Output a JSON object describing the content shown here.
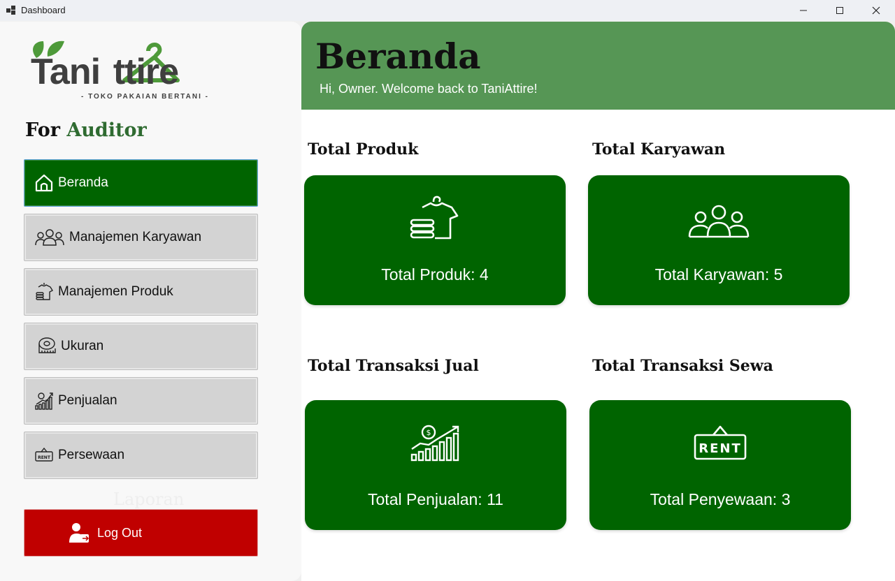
{
  "window": {
    "title": "Dashboard"
  },
  "sidebar": {
    "logo_text": "Tani  ttire",
    "logo_tagline": "- TOKO PAKAIAN BERTANI -",
    "role_prefix": "For",
    "role_name": "Auditor",
    "items": [
      {
        "label": "Beranda",
        "icon": "home-icon",
        "active": true
      },
      {
        "label": "Manajemen Karyawan",
        "icon": "people-icon",
        "active": false
      },
      {
        "label": "Manajemen Produk",
        "icon": "clothes-icon",
        "active": false
      },
      {
        "label": "Ukuran",
        "icon": "measuring-tape-icon",
        "active": false
      },
      {
        "label": "Penjualan",
        "icon": "sales-chart-icon",
        "active": false
      },
      {
        "label": "Persewaan",
        "icon": "rent-sign-icon",
        "active": false
      }
    ],
    "hidden_label": "Laporan",
    "logout_label": "Log Out"
  },
  "header": {
    "title": "Beranda",
    "welcome": "Hi, Owner. Welcome back  to TaniAttire!"
  },
  "stats": [
    {
      "heading": "Total Produk",
      "value_text": "Total Produk: 4",
      "icon": "clothes-icon"
    },
    {
      "heading": "Total Karyawan",
      "value_text": "Total Karyawan: 5",
      "icon": "people-icon"
    },
    {
      "heading": "Total Transaksi Jual",
      "value_text": "Total Penjualan: 11",
      "icon": "sales-chart-icon"
    },
    {
      "heading": "Total Transaksi Sewa",
      "value_text": "Total Penyewaan: 3",
      "icon": "rent-sign-icon"
    }
  ],
  "colors": {
    "accent_green": "#006400",
    "header_green": "#569655",
    "logout_red": "#c00000",
    "logo_leaf": "#4e9a3a"
  }
}
